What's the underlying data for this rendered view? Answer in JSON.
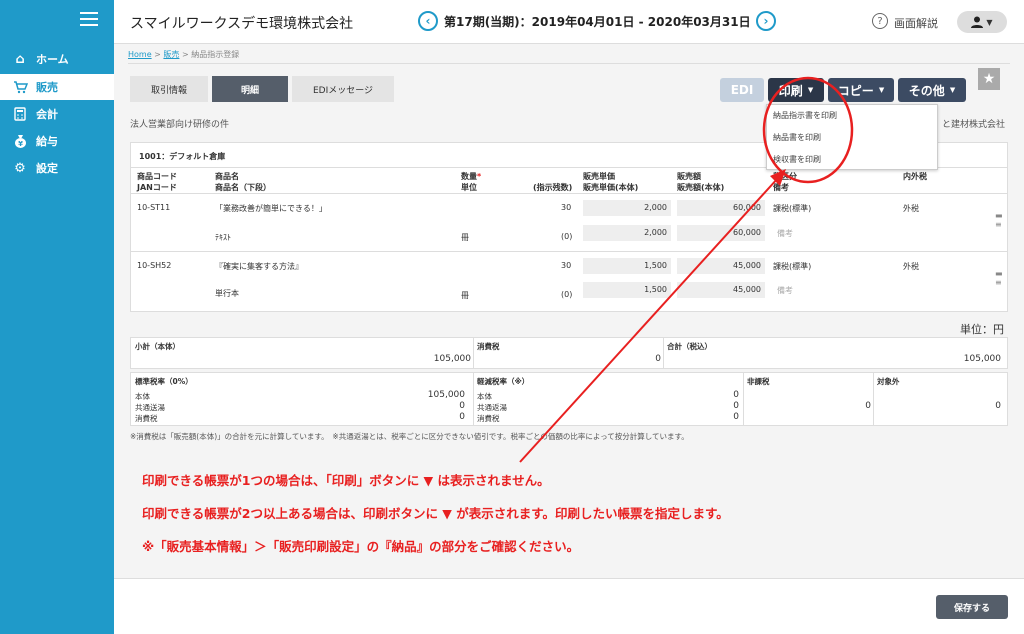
{
  "sidebar": {
    "items": [
      {
        "label": "ホーム",
        "icon": "home-icon"
      },
      {
        "label": "販売",
        "icon": "cart-icon"
      },
      {
        "label": "会計",
        "icon": "calculator-icon"
      },
      {
        "label": "給与",
        "icon": "money-bag-icon"
      },
      {
        "label": "設定",
        "icon": "gear-icon"
      }
    ]
  },
  "header": {
    "company": "スマイルワークスデモ環境株式会社",
    "period": "第17期(当期)：2019年04月01日 - 2020年03月31日",
    "help_label": "画面解説"
  },
  "breadcrumb": {
    "home": "Home",
    "sales": "販売",
    "current": "納品指示登録",
    "separator": ">"
  },
  "tabs": [
    "取引情報",
    "明細",
    "EDIメッセージ"
  ],
  "actions": {
    "edi": "EDI",
    "print": "印刷",
    "copy": "コピー",
    "other": "その他"
  },
  "print_menu": [
    "納品指示書を印刷",
    "納品書を印刷",
    "検収書を印刷"
  ],
  "subject": "法人営業部向け研修の件",
  "customer": "と建材株式会社",
  "warehouse": "1001：デフォルト倉庫",
  "columns": {
    "code": "商品コード",
    "jan": "JANコード",
    "name": "商品名",
    "name_sub": "商品名（下段）",
    "qty": "数量",
    "required": "*",
    "unit": "単位",
    "qty_note": "(指示残数)",
    "price": "販売単価",
    "price_sub": "販売単価(本体)",
    "amount": "販売額",
    "amount_sub": "販売額(本体)",
    "tax_class": "税区分",
    "remarks": "備考",
    "tax_type": "内外税"
  },
  "rows": [
    {
      "code": "10-ST11",
      "name": "「業務改善が簡単にできる！」",
      "name_sub": "ﾃｷｽﾄ",
      "qty": "30",
      "unit": "冊",
      "remaining": "(0)",
      "price": "2,000",
      "price_body": "2,000",
      "amount": "60,000",
      "amount_body": "60,000",
      "tax_class": "課税(標準)",
      "remarks_placeholder": "備考",
      "tax_type": "外税"
    },
    {
      "code": "10-SH52",
      "name": "『確実に集客する方法』",
      "name_sub": "単行本",
      "qty": "30",
      "unit": "冊",
      "remaining": "(0)",
      "price": "1,500",
      "price_body": "1,500",
      "amount": "45,000",
      "amount_body": "45,000",
      "tax_class": "課税(標準)",
      "remarks_placeholder": "備考",
      "tax_type": "外税"
    }
  ],
  "unit_label": "単位：円",
  "totals": {
    "subtotal_label": "小計（本体）",
    "subtotal": "105,000",
    "tax_label": "消費税",
    "tax": "0",
    "total_label": "合計（税込）",
    "total": "105,000"
  },
  "tax_breakdown": {
    "standard": {
      "title": "標準税率（0%）",
      "labels": [
        "本体",
        "共通送湯",
        "消費税"
      ],
      "values": [
        "105,000",
        "0",
        "0"
      ]
    },
    "reduced": {
      "title": "軽減税率（※）",
      "labels": [
        "本体",
        "共通返湯",
        "消費税"
      ],
      "values": [
        "0",
        "0",
        "0"
      ]
    },
    "nontax": {
      "title": "非課税",
      "value": "0"
    },
    "exempt": {
      "title": "対象外",
      "value": "0"
    }
  },
  "note": "※消費税は「販売額(本体)」の合計を元に計算しています。　※共通返湯とは、税率ごとに区分できない値引です。税率ごとの価額の比率によって按分計算しています。",
  "annotations": [
    "印刷できる帳票が1つの場合は、「印刷」ボタンに ▼ は表示されません。",
    "印刷できる帳票が2つ以上ある場合は、印刷ボタンに ▼ が表示されます。印刷したい帳票を指定します。",
    "※「販売基本情報」＞「販売印刷設定」の『納品』の部分をご確認ください。"
  ],
  "save_label": "保存する",
  "colors": {
    "sidebar": "#1f9ac9",
    "annotation": "#e82020",
    "primary_button": "#3c4b63"
  }
}
